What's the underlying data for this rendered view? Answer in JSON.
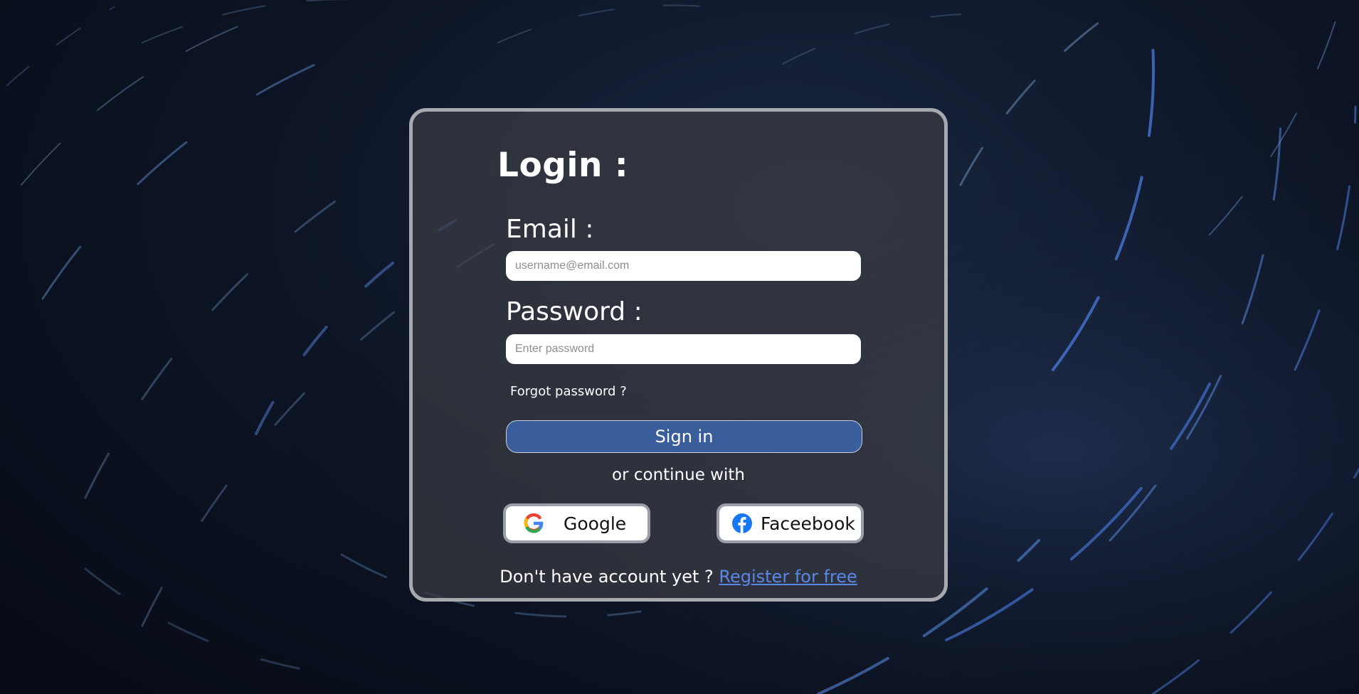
{
  "login": {
    "title": "Login :",
    "email_label": "Email :",
    "email_placeholder": "username@email.com",
    "password_label": "Password :",
    "password_placeholder": "Enter password",
    "forgot_password": "Forgot password ?",
    "signin_label": "Sign in",
    "or_continue": "or continue with",
    "google_label": "Google",
    "facebook_label": "Faceebook",
    "no_account_text": "Don't have account yet ?",
    "register_link": "Register for free"
  },
  "icons": {
    "google": "google-icon",
    "facebook": "facebook-icon"
  },
  "colors": {
    "signin_button": "#3a5d9b",
    "register_link": "#5a86e6",
    "card_border": "#a6a9ad",
    "facebook_blue": "#1877f2"
  }
}
